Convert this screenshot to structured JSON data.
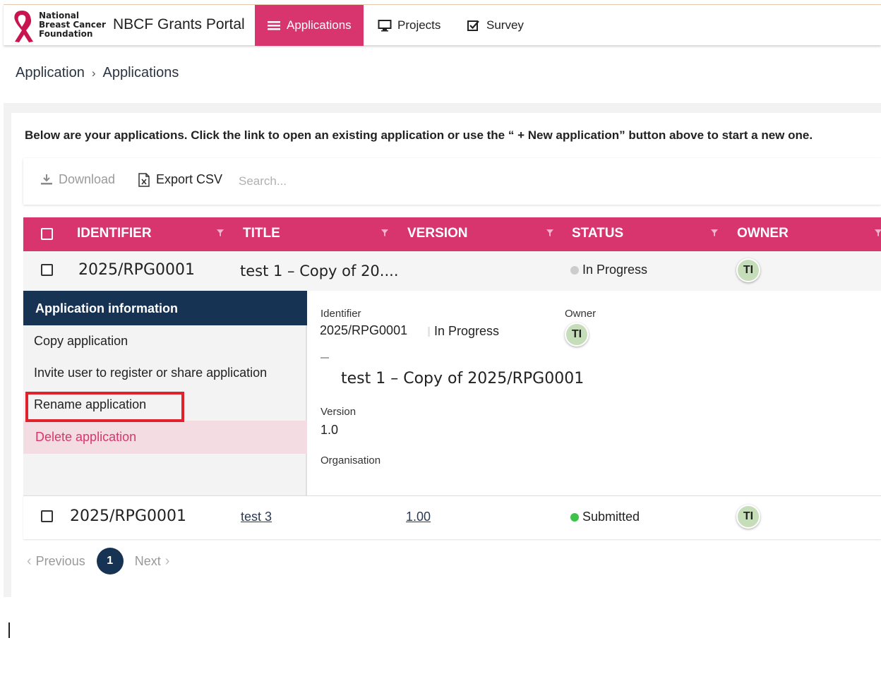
{
  "header": {
    "org_name_line1": "National",
    "org_name_line2": "Breast Cancer",
    "org_name_line3": "Foundation",
    "portal_title": "NBCF Grants Portal",
    "nav": [
      {
        "label": "Applications",
        "icon": "list-icon",
        "active": true
      },
      {
        "label": "Projects",
        "icon": "monitor-icon",
        "active": false
      },
      {
        "label": "Survey",
        "icon": "checkbox-icon",
        "active": false
      }
    ],
    "accent_color": "#d8356e"
  },
  "breadcrumb": [
    "Application",
    "Applications"
  ],
  "intro_text": "Below are your applications. Click the link to open an existing application or use the “ + New application” button above to start a new one.",
  "toolbar": {
    "download_label": "Download",
    "export_label": "Export CSV",
    "search_placeholder": "Search..."
  },
  "table": {
    "columns": [
      "IDENTIFIER",
      "TITLE",
      "VERSION",
      "STATUS",
      "OWNER"
    ],
    "rows": [
      {
        "identifier": "2025/RPG0001",
        "title": "test 1 – Copy of 20....",
        "version": "",
        "status": "In Progress",
        "status_color": "#cccccc",
        "owner": "TI"
      },
      {
        "identifier": "2025/RPG0001",
        "title": "test 3",
        "version": "1.00",
        "status": "Submitted",
        "status_color": "#3cc34a",
        "owner": "TI"
      }
    ]
  },
  "details": {
    "menu_header": "Application information",
    "menu_items": [
      "Copy application",
      "Invite user to register or share application",
      "Rename application"
    ],
    "delete_label": "Delete application",
    "identifier_label": "Identifier",
    "identifier_value": "2025/RPG0001",
    "status_value": "In Progress",
    "owner_label": "Owner",
    "owner_value": "TI",
    "full_title": "test 1 – Copy of 2025/RPG0001",
    "version_label": "Version",
    "version_value": "1.0",
    "organisation_label": "Organisation"
  },
  "pagination": {
    "previous_label": "Previous",
    "current_page": "1",
    "next_label": "Next"
  }
}
